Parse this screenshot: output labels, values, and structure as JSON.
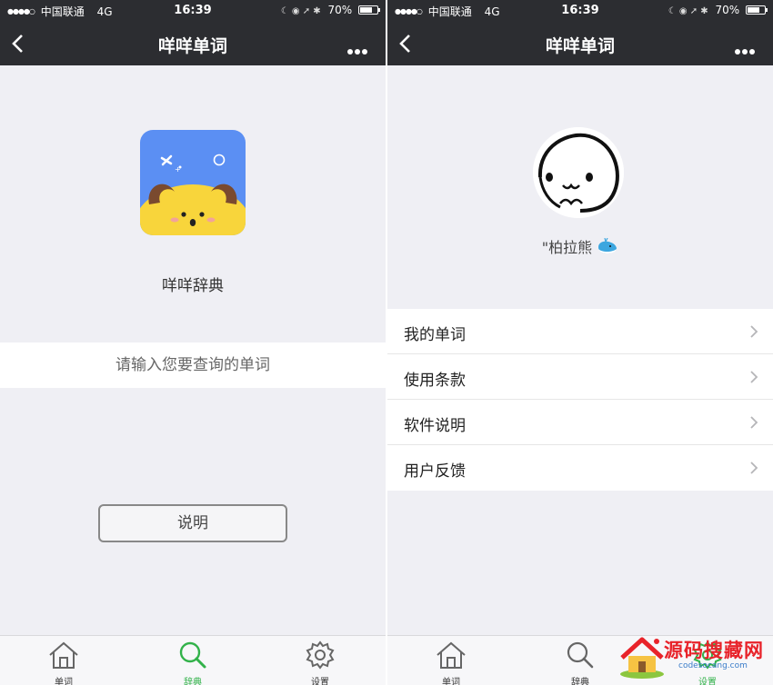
{
  "status_bar": {
    "carrier": "中国联通",
    "network": "4G",
    "time": "16:39",
    "battery": "70%",
    "battery_level": 0.7
  },
  "left_screen": {
    "nav_title": "咩咩单词",
    "app_name": "咩咩辞典",
    "search": {
      "placeholder": "请输入您要查询的单词",
      "value": ""
    },
    "info_button": "说明",
    "tabs": [
      {
        "label": "单词",
        "icon": "home-icon",
        "active": false
      },
      {
        "label": "辞典",
        "icon": "search-icon",
        "active": true
      },
      {
        "label": "设置",
        "icon": "gear-icon",
        "active": false
      }
    ]
  },
  "right_screen": {
    "nav_title": "咩咩单词",
    "username": "\"柏拉熊",
    "menu": [
      {
        "label": "我的单词"
      },
      {
        "label": "使用条款"
      },
      {
        "label": "软件说明"
      },
      {
        "label": "用户反馈"
      }
    ],
    "tabs": [
      {
        "label": "单词",
        "icon": "home-icon",
        "active": false
      },
      {
        "label": "辞典",
        "icon": "search-icon",
        "active": false
      },
      {
        "label": "设置",
        "icon": "gear-icon",
        "active": true
      }
    ]
  },
  "watermark": {
    "text": "源码搜藏网",
    "url": "codesocang.com"
  },
  "colors": {
    "nav_bg": "#2c2d31",
    "page_bg": "#efeff4",
    "accent_green": "#32b24a",
    "logo_blue": "#5b8ff3",
    "logo_yellow": "#f8d53b",
    "watermark_red": "#e8232a"
  }
}
